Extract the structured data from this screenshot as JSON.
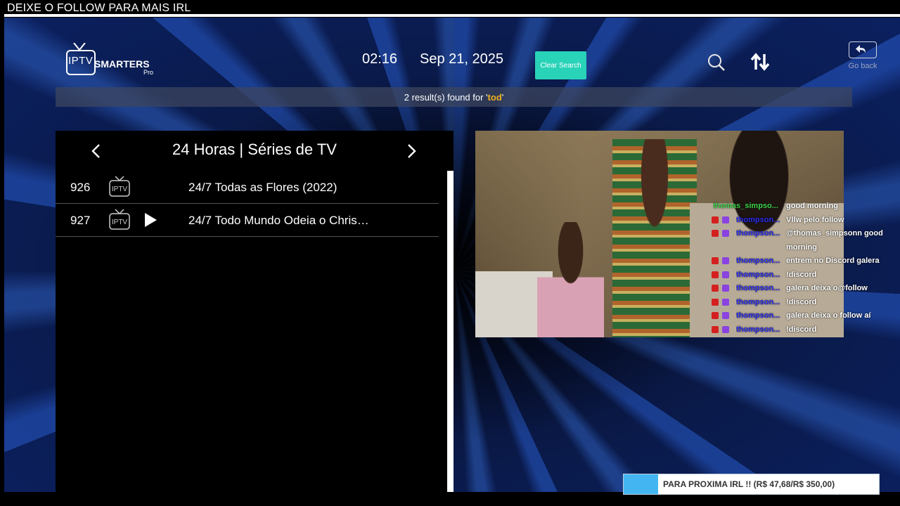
{
  "overlay": {
    "banner_text": "DEIXE O FOLLOW PARA MAIS IRL",
    "goal_label": "PARA PROXIMA IRL !! (R$ 47,68/R$ 350,00)",
    "goal_progress": 0.136
  },
  "header": {
    "logo_iptv": "IPTV",
    "logo_smarters": "SMARTERS",
    "logo_pro": "Pro",
    "time": "02:16",
    "date": "Sep 21, 2025",
    "clear_search_label": "Clear Search",
    "go_back_label": "Go back",
    "icons": [
      "search-icon",
      "sort-icon",
      "back-arrow-icon"
    ]
  },
  "results": {
    "prefix": "2 result(s) found for '",
    "query": "tod",
    "suffix": "'"
  },
  "category": {
    "title": "24 Horas | Séries de TV"
  },
  "channels": [
    {
      "number": "926",
      "title": "24/7 Todas as Flores (2022)",
      "playing": false
    },
    {
      "number": "927",
      "title": "24/7 Todo Mundo Odeia o Chris…",
      "playing": true
    }
  ],
  "chat": [
    {
      "user": "thomas_simpso...",
      "message": "good morning",
      "style": "green"
    },
    {
      "user": "thompson...",
      "message": "Vllw pelo follow",
      "style": "blue"
    },
    {
      "user": "thompson...",
      "message": "@thomas_simpsonn good",
      "style": "blue"
    },
    {
      "user": "",
      "message": "morning",
      "style": "cont"
    },
    {
      "user": "thompson...",
      "message": "entrem no Discord galera",
      "style": "blue"
    },
    {
      "user": "thompson...",
      "message": "!discord",
      "style": "blue"
    },
    {
      "user": "thompson...",
      "message": "galera deixa o@follow",
      "style": "blue"
    },
    {
      "user": "thompson...",
      "message": "!discord",
      "style": "blue"
    },
    {
      "user": "thompson...",
      "message": "galera deixa o follow aí",
      "style": "blue"
    },
    {
      "user": "thompson...",
      "message": "!discord",
      "style": "blue"
    }
  ],
  "colors": {
    "accent": "#29d3b8",
    "query_highlight": "#f0b020",
    "progress_fill": "#43b6f2"
  }
}
